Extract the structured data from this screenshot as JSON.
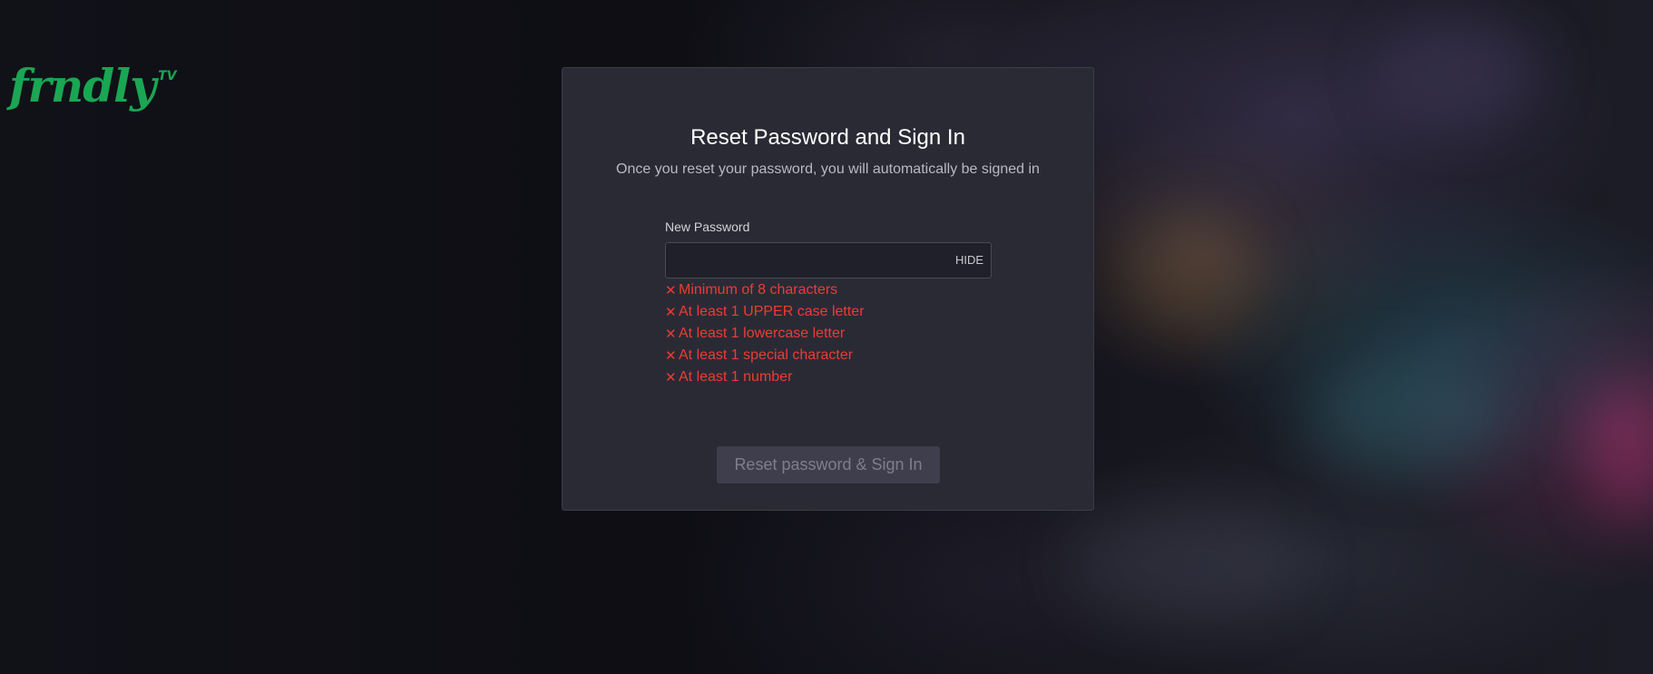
{
  "brand": {
    "name": "frndly",
    "suffix": "TV",
    "color": "#1aa653"
  },
  "card": {
    "title": "Reset Password and Sign In",
    "subtitle": "Once you reset your password, you will automatically be signed in"
  },
  "form": {
    "password_label": "New Password",
    "password_value": "",
    "toggle_label": "HIDE",
    "submit_label": "Reset password & Sign In",
    "submit_disabled": true
  },
  "requirements": {
    "status_icon": "close-x-icon",
    "error_color": "#ef3b33",
    "items": [
      {
        "label": "Minimum of 8 characters",
        "met": false
      },
      {
        "label": "At least 1 UPPER case letter",
        "met": false
      },
      {
        "label": "At least 1 lowercase letter",
        "met": false
      },
      {
        "label": "At least 1 special character",
        "met": false
      },
      {
        "label": "At least 1 number",
        "met": false
      }
    ]
  }
}
